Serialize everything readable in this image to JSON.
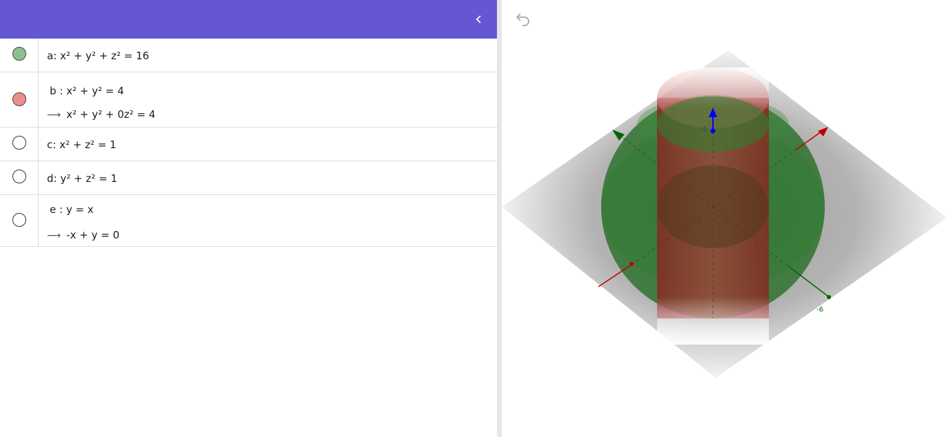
{
  "algebra": {
    "items": [
      {
        "name": "a",
        "input": "a: x² + y² + z² = 16",
        "output": "",
        "marble_color": "#8fbf8f",
        "visible": true
      },
      {
        "name": "b",
        "input": "b : x² + y² = 4",
        "output": "x² + y² + 0z² = 4",
        "marble_color": "#ee8e8e",
        "visible": true
      },
      {
        "name": "c",
        "input": "c: x² + z² = 1",
        "output": "",
        "marble_color": "#ffffff",
        "visible": false
      },
      {
        "name": "d",
        "input": "d: y² + z² = 1",
        "output": "",
        "marble_color": "#ffffff",
        "visible": false
      },
      {
        "name": "e",
        "input": "e : y = x",
        "output": "-x + y = 0",
        "marble_color": "#ffffff",
        "visible": false
      }
    ],
    "output_arrow": "⟶"
  },
  "header": {
    "color": "#6557d2",
    "collapse_icon": "chevron-left-icon"
  },
  "graphics": {
    "undo_icon": "undo-icon",
    "axis_labels": {
      "z_tick": "4",
      "y_tick": "-6"
    },
    "colors": {
      "sphere": "#1e6b1e",
      "cylinder": "#a52a2a",
      "x_axis": "#c00000",
      "y_axis": "#006400",
      "z_axis": "#0000ff"
    }
  }
}
